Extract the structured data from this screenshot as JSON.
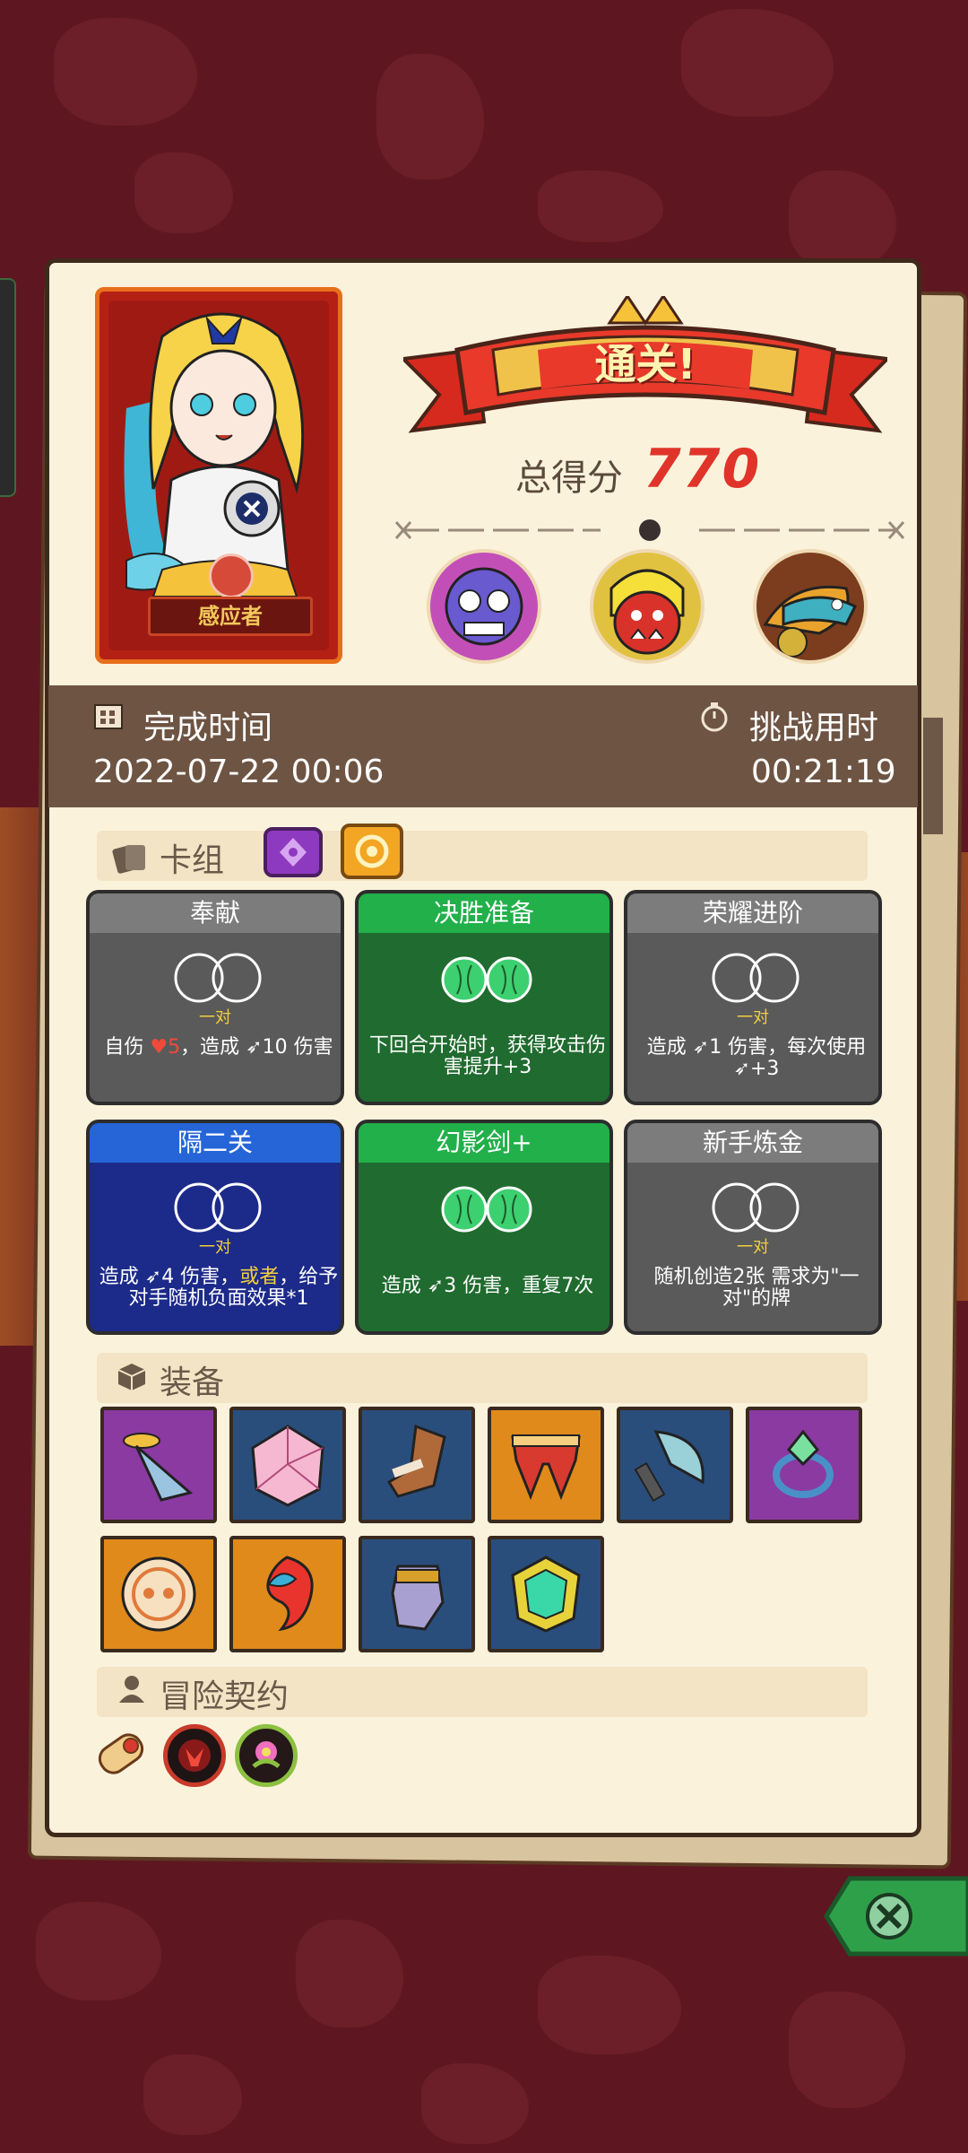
{
  "hero": {
    "name": "感应者"
  },
  "result": {
    "banner": "通关!",
    "score_label": "总得分",
    "score": "770"
  },
  "times": {
    "complete_label": "完成时间",
    "complete_value": "2022-07-22 00:06",
    "challenge_label": "挑战用时",
    "challenge_value": "00:21:19"
  },
  "deck": {
    "title": "卡组",
    "cards": [
      {
        "title": "奉献",
        "pair": "一对",
        "desc_a": "自伤 ",
        "desc_hp": "♥5",
        "desc_b": "，造成 ➶10 伤害",
        "color": "gray"
      },
      {
        "title": "决胜准备",
        "pair": "",
        "desc": "下回合开始时，获得攻击伤害提升+3",
        "color": "green"
      },
      {
        "title": "荣耀进阶",
        "pair": "一对",
        "desc": "造成 ➶1 伤害，每次使用➶+3",
        "color": "gray"
      },
      {
        "title": "隔二关",
        "pair": "一对",
        "desc_a": "造成 ➶4 伤害，",
        "desc_hl": "或者",
        "desc_b": "，给予对手随机负面效果*1",
        "color": "blue"
      },
      {
        "title": "幻影剑+",
        "pair": "",
        "desc": "造成 ➶3 伤害，重复7次",
        "color": "green"
      },
      {
        "title": "新手炼金",
        "pair": "一对",
        "desc": "随机创造2张 需求为\"一对\"的牌",
        "color": "gray"
      }
    ]
  },
  "equipment": {
    "title": "装备"
  },
  "contracts": {
    "title": "冒险契约"
  },
  "colors": {
    "panel": "#fbf2dc",
    "band": "#6e5443",
    "score": "#e0342a",
    "accent_yellow": "#f3cf3c"
  }
}
